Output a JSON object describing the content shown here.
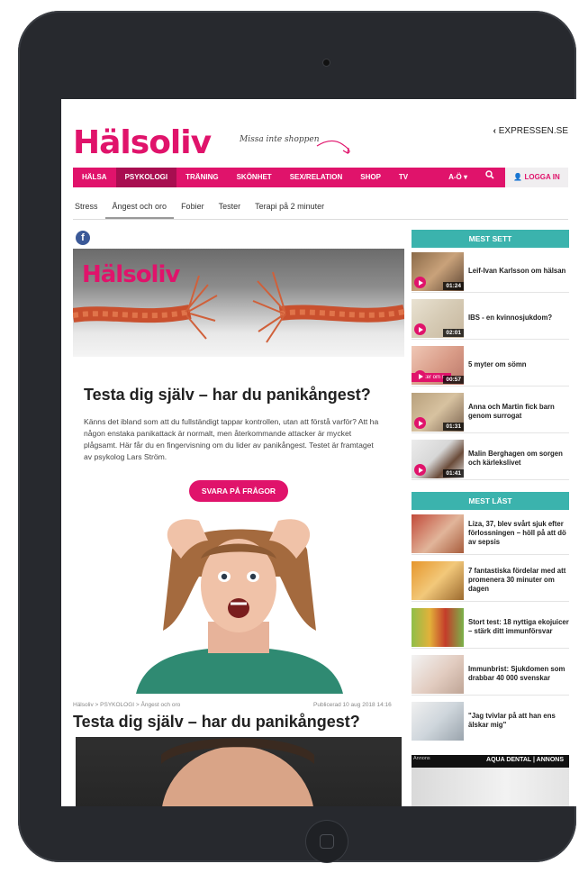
{
  "site": {
    "logo": "Hälsoliv",
    "shop_tip": "Missa inte shoppen",
    "expressen_link": "EXPRESSEN.SE"
  },
  "nav": {
    "items": [
      "HÄLSA",
      "PSYKOLOGI",
      "TRÄNING",
      "SKÖNHET",
      "SEX/RELATION",
      "SHOP",
      "TV"
    ],
    "active": "PSYKOLOGI",
    "az": "A-Ö ▾",
    "login": "LOGGA IN"
  },
  "subnav": {
    "items": [
      "Stress",
      "Ångest och oro",
      "Fobier",
      "Tester",
      "Terapi på 2 minuter"
    ],
    "active": "Ångest och oro"
  },
  "quiz": {
    "hero_logo": "Hälsoliv",
    "title": "Testa dig själv – har du panikångest?",
    "intro": "Känns det ibland som att du fullständigt tappar kontrollen, utan att förstå varför? Att ha någon enstaka panikattack är normalt, men återkommande attacker är mycket plågsamt. Här får du en fingervisning om du lider av panikångest. Testet är framtaget av psykolog Lars Ström.",
    "button": "SVARA PÅ FRÅGOR"
  },
  "article": {
    "breadcrumb": "Hälsoliv  >  PSYKOLOGI  >  Ångest och oro",
    "published": "Publicerad 10 aug 2018 14:16",
    "title": "Testa dig själv – har du panikångest?"
  },
  "sidebar": {
    "most_viewed_title": "MEST SETT",
    "most_viewed": [
      {
        "title": "Leif-Ivan Karlsson om hälsan",
        "duration": "01:24"
      },
      {
        "title": "IBS - en kvinnosjukdom?",
        "duration": "02:01"
      },
      {
        "title": "5 myter om sömn",
        "duration": "00:57",
        "overlay": "yter om s"
      },
      {
        "title": "Anna och Martin fick barn genom surrogat",
        "duration": "01:31"
      },
      {
        "title": "Malin Berghagen om sorgen och kärlekslivet",
        "duration": "01:41"
      }
    ],
    "most_read_title": "MEST LÄST",
    "most_read": [
      {
        "title": "Liza, 37, blev svårt sjuk efter förlossningen – höll på att dö av sepsis"
      },
      {
        "title": "7 fantastiska fördelar med att promenera 30 minuter om dagen"
      },
      {
        "title": "Stort test: 18 nyttiga ekojuicer – stärk ditt immunförsvar"
      },
      {
        "title": "Immunbrist: Sjukdomen som drabbar 40 000 svenskar"
      },
      {
        "title": "\"Jag tvivlar på att han ens älskar mig\""
      }
    ],
    "ad": {
      "label": "Annons",
      "text": "AQUA DENTAL  |  ANNONS"
    }
  },
  "colors": {
    "brand": "#e0136b",
    "accent_teal": "#3bb3ad",
    "device": "#27292e"
  }
}
